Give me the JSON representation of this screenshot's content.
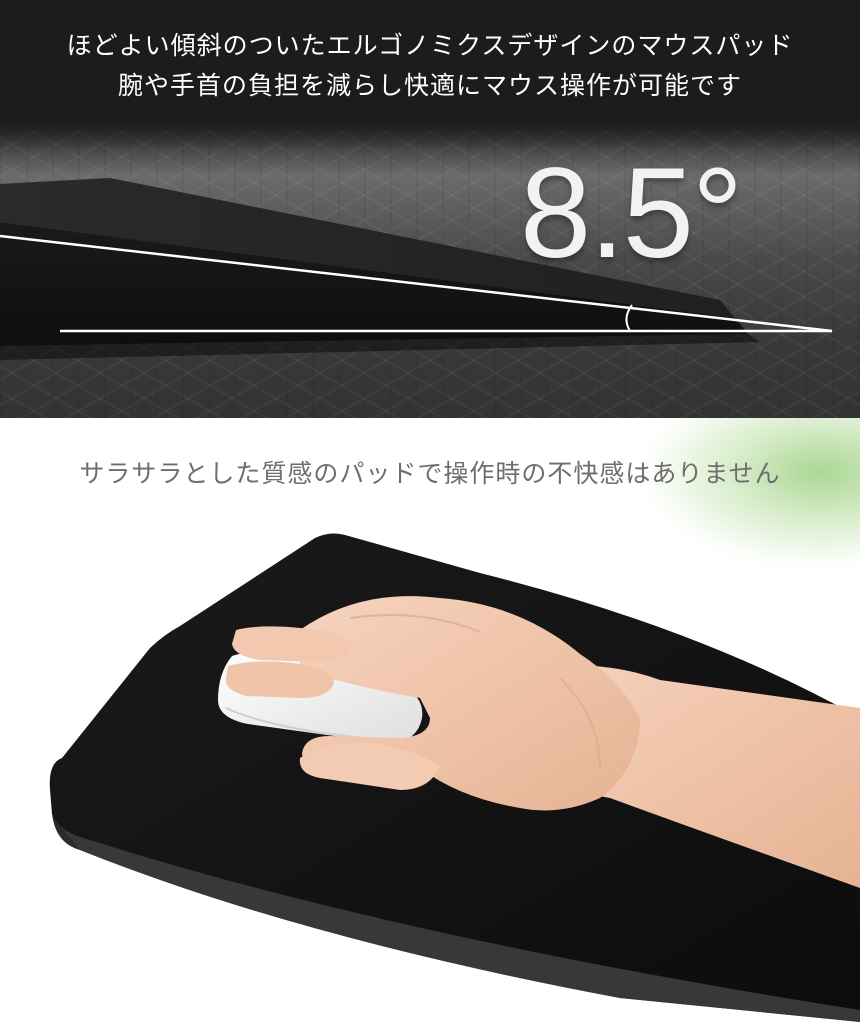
{
  "top_section": {
    "caption_line1": "ほどよい傾斜のついたエルゴノミクスデザインのマウスパッド",
    "caption_line2": "腕や手首の負担を減らし快適にマウス操作が可能です",
    "angle_label": "8.5°"
  },
  "bottom_section": {
    "caption": "サラサラとした質感のパッドで操作時の不快感はありません"
  }
}
